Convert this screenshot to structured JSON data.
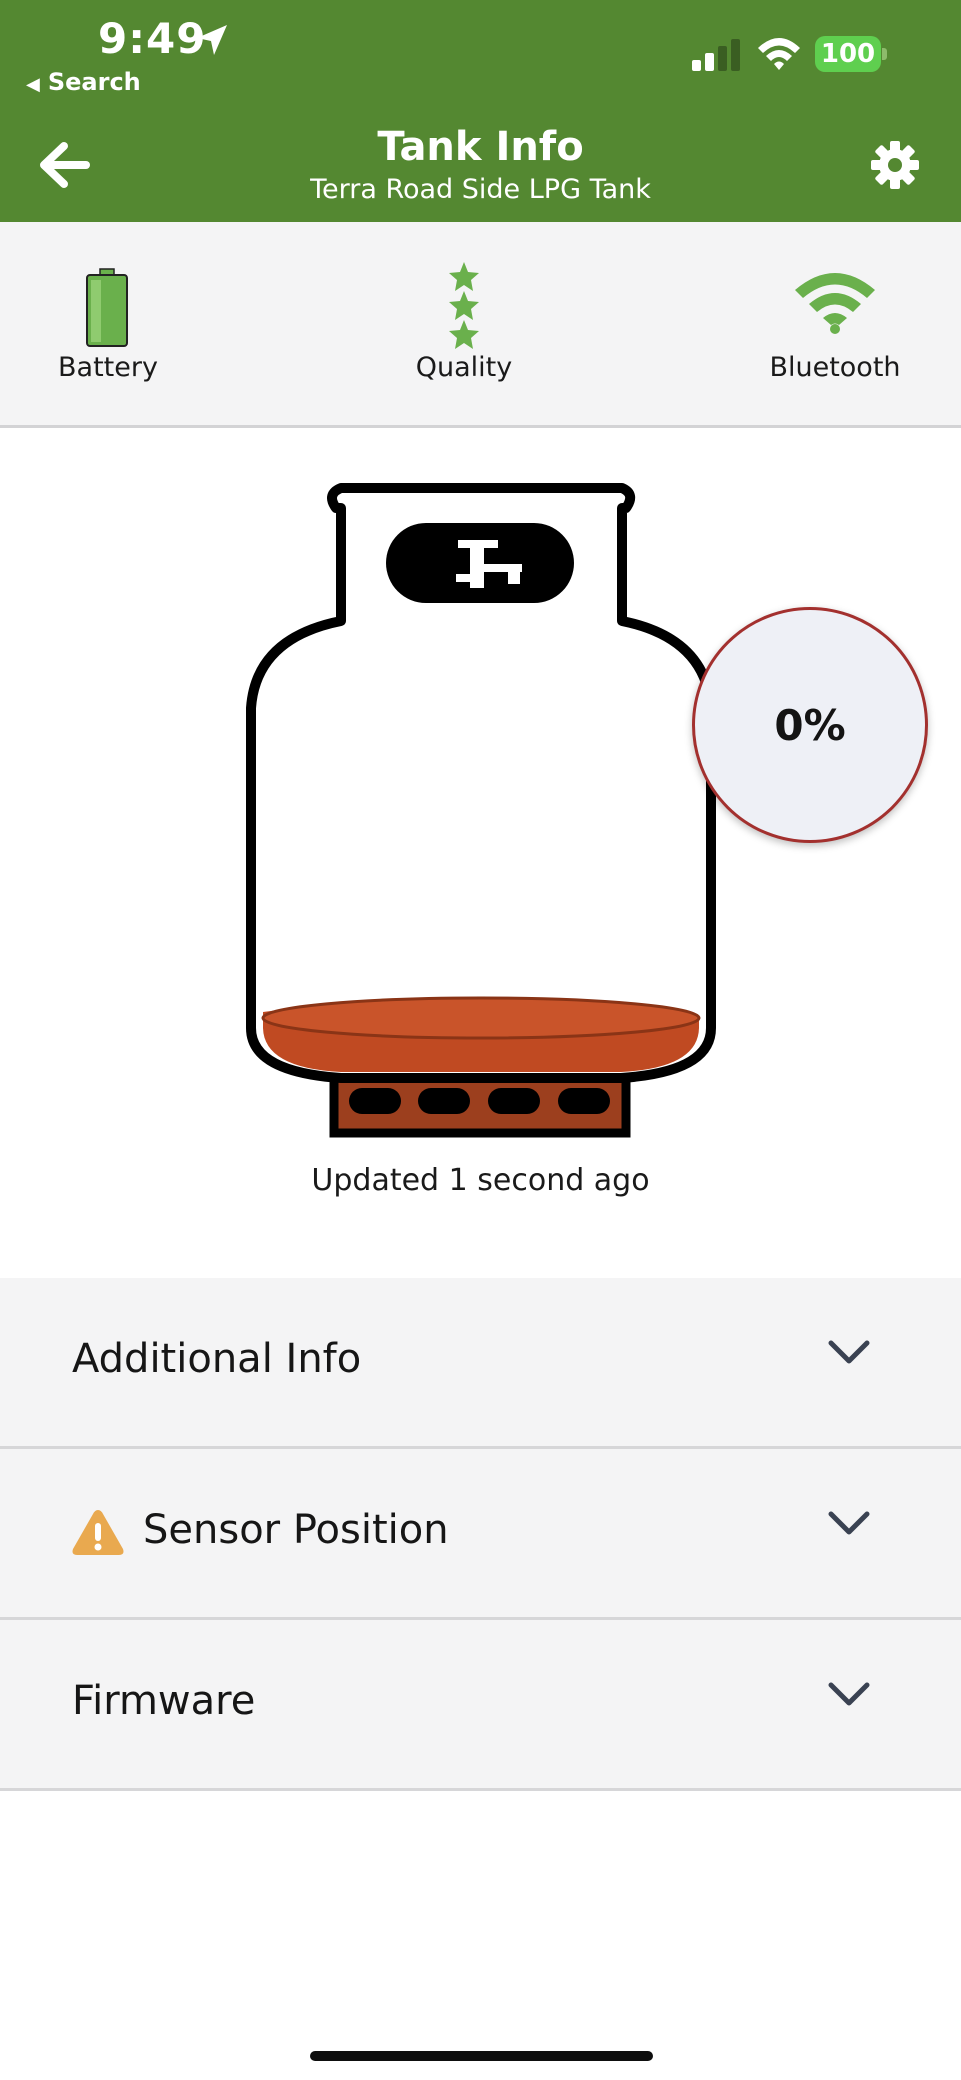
{
  "status_bar": {
    "time": "9:49",
    "back_app": "Search",
    "battery": "100"
  },
  "header": {
    "title": "Tank Info",
    "subtitle": "Terra Road Side LPG Tank",
    "icons": [
      "back-arrow-icon",
      "gear-icon"
    ]
  },
  "indicators": [
    {
      "label": "Battery",
      "icon": "battery-icon"
    },
    {
      "label": "Quality",
      "icon": "stars-icon",
      "stars": 3
    },
    {
      "label": "Bluetooth",
      "icon": "wifi-signal-icon"
    }
  ],
  "tank": {
    "level": "0%",
    "updated": "Updated 1 second ago"
  },
  "sections": [
    {
      "label": "Additional Info",
      "warning": false
    },
    {
      "label": "Sensor Position",
      "warning": true
    },
    {
      "label": "Firmware",
      "warning": false
    }
  ],
  "colors": {
    "header_green": "#548831",
    "indicator_green": "#6ab04c",
    "liquid_orange": "#c04a22",
    "level_ring": "#a3302e",
    "warning_orange": "#e9a94f"
  }
}
